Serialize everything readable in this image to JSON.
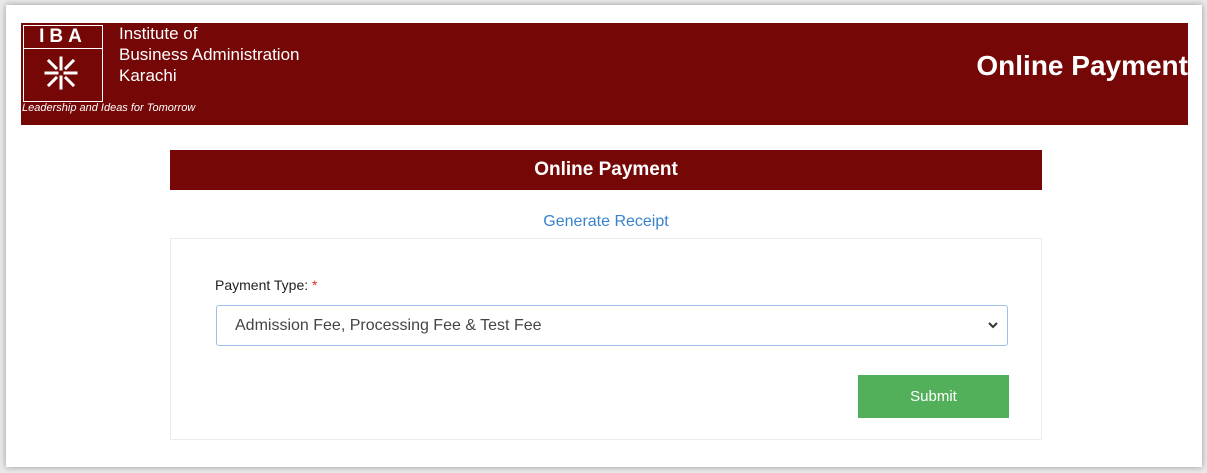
{
  "header": {
    "logo_text": "IBA",
    "institute_lines": [
      "Institute of",
      "Business Administration",
      "Karachi"
    ],
    "tagline": "Leadership and Ideas for Tomorrow",
    "title": "Online Payment"
  },
  "main": {
    "section_title": "Online Payment",
    "receipt_link": "Generate Receipt",
    "form": {
      "payment_type_label": "Payment Type:",
      "required_mark": "*",
      "payment_type_value": "Admission Fee, Processing Fee & Test Fee",
      "submit_label": "Submit"
    }
  },
  "colors": {
    "brand_maroon": "#750707",
    "submit_green": "#52b05a",
    "link_blue": "#3a82cc"
  },
  "icons": [
    "iba-emblem-icon",
    "chevron-down-icon"
  ]
}
